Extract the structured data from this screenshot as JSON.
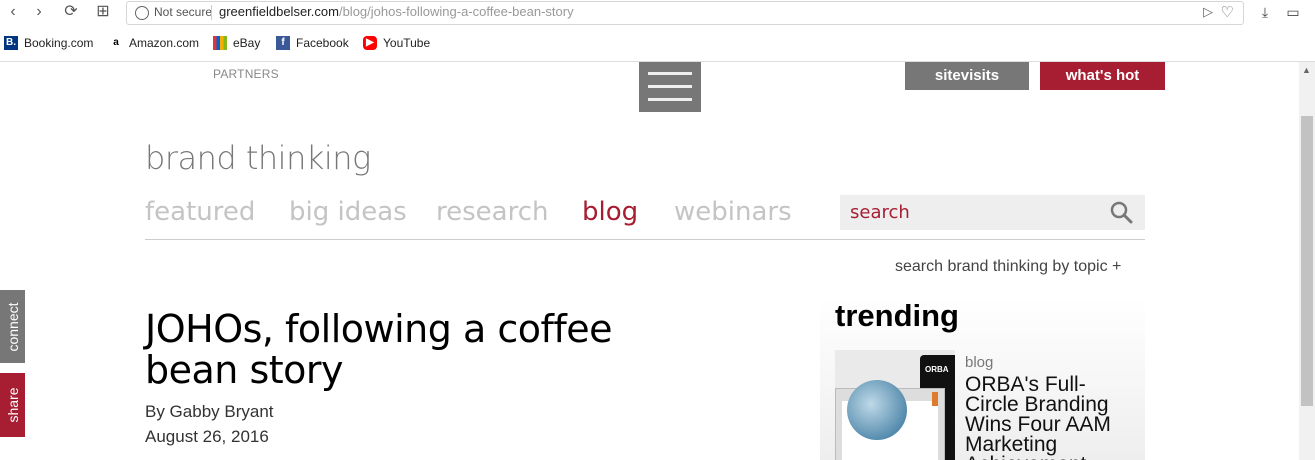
{
  "browser": {
    "security_label": "Not secure",
    "url_domain": "greenfieldbelser.com",
    "url_path": "/blog/johos-following-a-coffee-bean-story"
  },
  "bookmarks": [
    {
      "label": "Booking.com",
      "icon": "booking-icon",
      "color": "#003580"
    },
    {
      "label": "Amazon.com",
      "icon": "amazon-icon",
      "color": "#ffffff"
    },
    {
      "label": "eBay",
      "icon": "ebay-icon",
      "color": "#e53238"
    },
    {
      "label": "Facebook",
      "icon": "facebook-icon",
      "color": "#3b5998"
    },
    {
      "label": "YouTube",
      "icon": "youtube-icon",
      "color": "#ff0000"
    }
  ],
  "header": {
    "partners": "PARTNERS",
    "sitevisits": "sitevisits",
    "whats_hot": "what's hot"
  },
  "section_title": "brand thinking",
  "nav": {
    "items": [
      "featured",
      "big ideas",
      "research",
      "blog",
      "webinars"
    ],
    "active": "blog"
  },
  "search": {
    "placeholder": "search"
  },
  "topic_link": "search brand thinking by topic +",
  "article": {
    "title": "JOHOs, following a coffee bean story",
    "byline": "By Gabby Bryant",
    "date": "August 26, 2016"
  },
  "trending": {
    "heading": "trending",
    "item": {
      "category": "blog",
      "title": "ORBA's Full-Circle Branding Wins Four AAM Marketing Achievement",
      "thumb_label": "ORBA"
    }
  },
  "side_tabs": {
    "connect": "connect",
    "share": "share"
  },
  "colors": {
    "accent": "#a71d31",
    "gray_button": "#777777"
  }
}
